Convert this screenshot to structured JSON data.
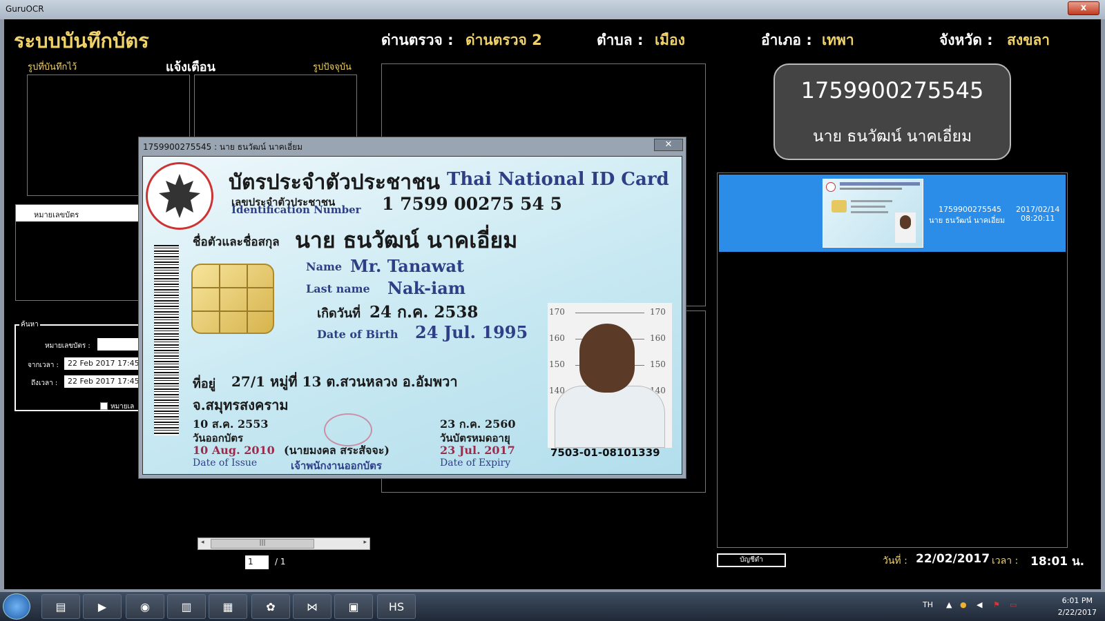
{
  "window": {
    "title": "GuruOCR",
    "close_glyph": "x"
  },
  "header": {
    "app_title": "ระบบบันทึกบัตร",
    "checkpoint_label": "ด่านตรวจ :",
    "checkpoint_value": "ด่านตรวจ 2",
    "subdistrict_label": "ตำบล :",
    "subdistrict_value": "เมือง",
    "district_label": "อำเภอ :",
    "district_value": "เทพา",
    "province_label": "จังหวัด :",
    "province_value": "สงขลา"
  },
  "left": {
    "saved_photo_label": "รูปที่บันทึกไว้",
    "warning_label": "แจ้งเตือน",
    "current_photo_label": "รูปปัจจุบัน",
    "idcard_panel_header": "หมายเลขบัตร"
  },
  "search": {
    "legend": "ค้นหา",
    "card_number_label": "หมายเลขบัตร :",
    "card_number_value": "",
    "from_label": "จากเวลา :",
    "from_value": "22 Feb 2017  17:45",
    "to_label": "ถึงเวลา :",
    "to_value": "22 Feb 2017  17:45",
    "checkbox_label": "หมายเล"
  },
  "pager": {
    "current": "1",
    "total": "/ 1",
    "thumb_glyph": "|||",
    "left_arrow": "◂",
    "right_arrow": "▸"
  },
  "dialog": {
    "title": "1759900275545 : นาย ธนวัฒน์ นาคเอี่ยม",
    "close_glyph": "✕",
    "card": {
      "title_th": "บัตรประจำตัวประชาชน",
      "title_en": "Thai National ID Card",
      "idno_label_th": "เลขประจำตัวประชาชน",
      "idno_label_en": "Identification Number",
      "idno": "1 7599 00275 54 5",
      "name_label_th": "ชื่อตัวและชื่อสกุล",
      "name_th": "นาย ธนวัฒน์  นาคเอี่ยม",
      "name_label_en": "Name",
      "name_en": "Mr. Tanawat",
      "lastname_label_en": "Last name",
      "lastname_en": "Nak-iam",
      "dob_label_th": "เกิดวันที่",
      "dob_th": "24 ก.ค. 2538",
      "dob_label_en": "Date of Birth",
      "dob_en": "24 Jul. 1995",
      "address_label": "ที่อยู่",
      "address_line1": "27/1 หมู่ที่ 13 ต.สวนหลวง อ.อัมพวา",
      "address_line2": "จ.สมุทรสงคราม",
      "issue_th": "10 ส.ค. 2553",
      "issue_label_th": "วันออกบัตร",
      "issue_en": "10 Aug. 2010",
      "issue_label_en": "Date of Issue",
      "officer_name": "(นายมงคล  สระสัจจะ)",
      "officer_title": "เจ้าพนักงานออกบัตร",
      "expiry_th": "23 ก.ค. 2560",
      "expiry_label_th": "วันบัตรหมดอายุ",
      "expiry_en": "23 Jul. 2017",
      "expiry_label_en": "Date of Expiry",
      "serial": "7503-01-08101339",
      "heights": [
        "170",
        "160",
        "150",
        "140"
      ]
    }
  },
  "right": {
    "id_number": "1759900275545",
    "person_name": "นาย ธนวัฒน์ นาคเอี่ยม",
    "list": [
      {
        "id": "1759900275545",
        "name": "นาย ธนวัฒน์ นาคเอี่ยม",
        "date": "2017/02/14",
        "time": "08:20:11"
      }
    ],
    "account_button": "บัญชีดำ",
    "date_label": "วันที่ :",
    "date_value": "22/02/2017",
    "time_label": "เวลา :",
    "time_value": "18:01 น."
  },
  "taskbar": {
    "lang": "TH",
    "time": "6:01 PM",
    "date": "2/22/2017",
    "items": [
      "file-explorer-icon",
      "media-player-icon",
      "chrome-icon",
      "chart-app-icon",
      "apps-grid-icon",
      "settings-icon",
      "visual-studio-icon",
      "document-icon",
      "hs-app-icon"
    ]
  }
}
